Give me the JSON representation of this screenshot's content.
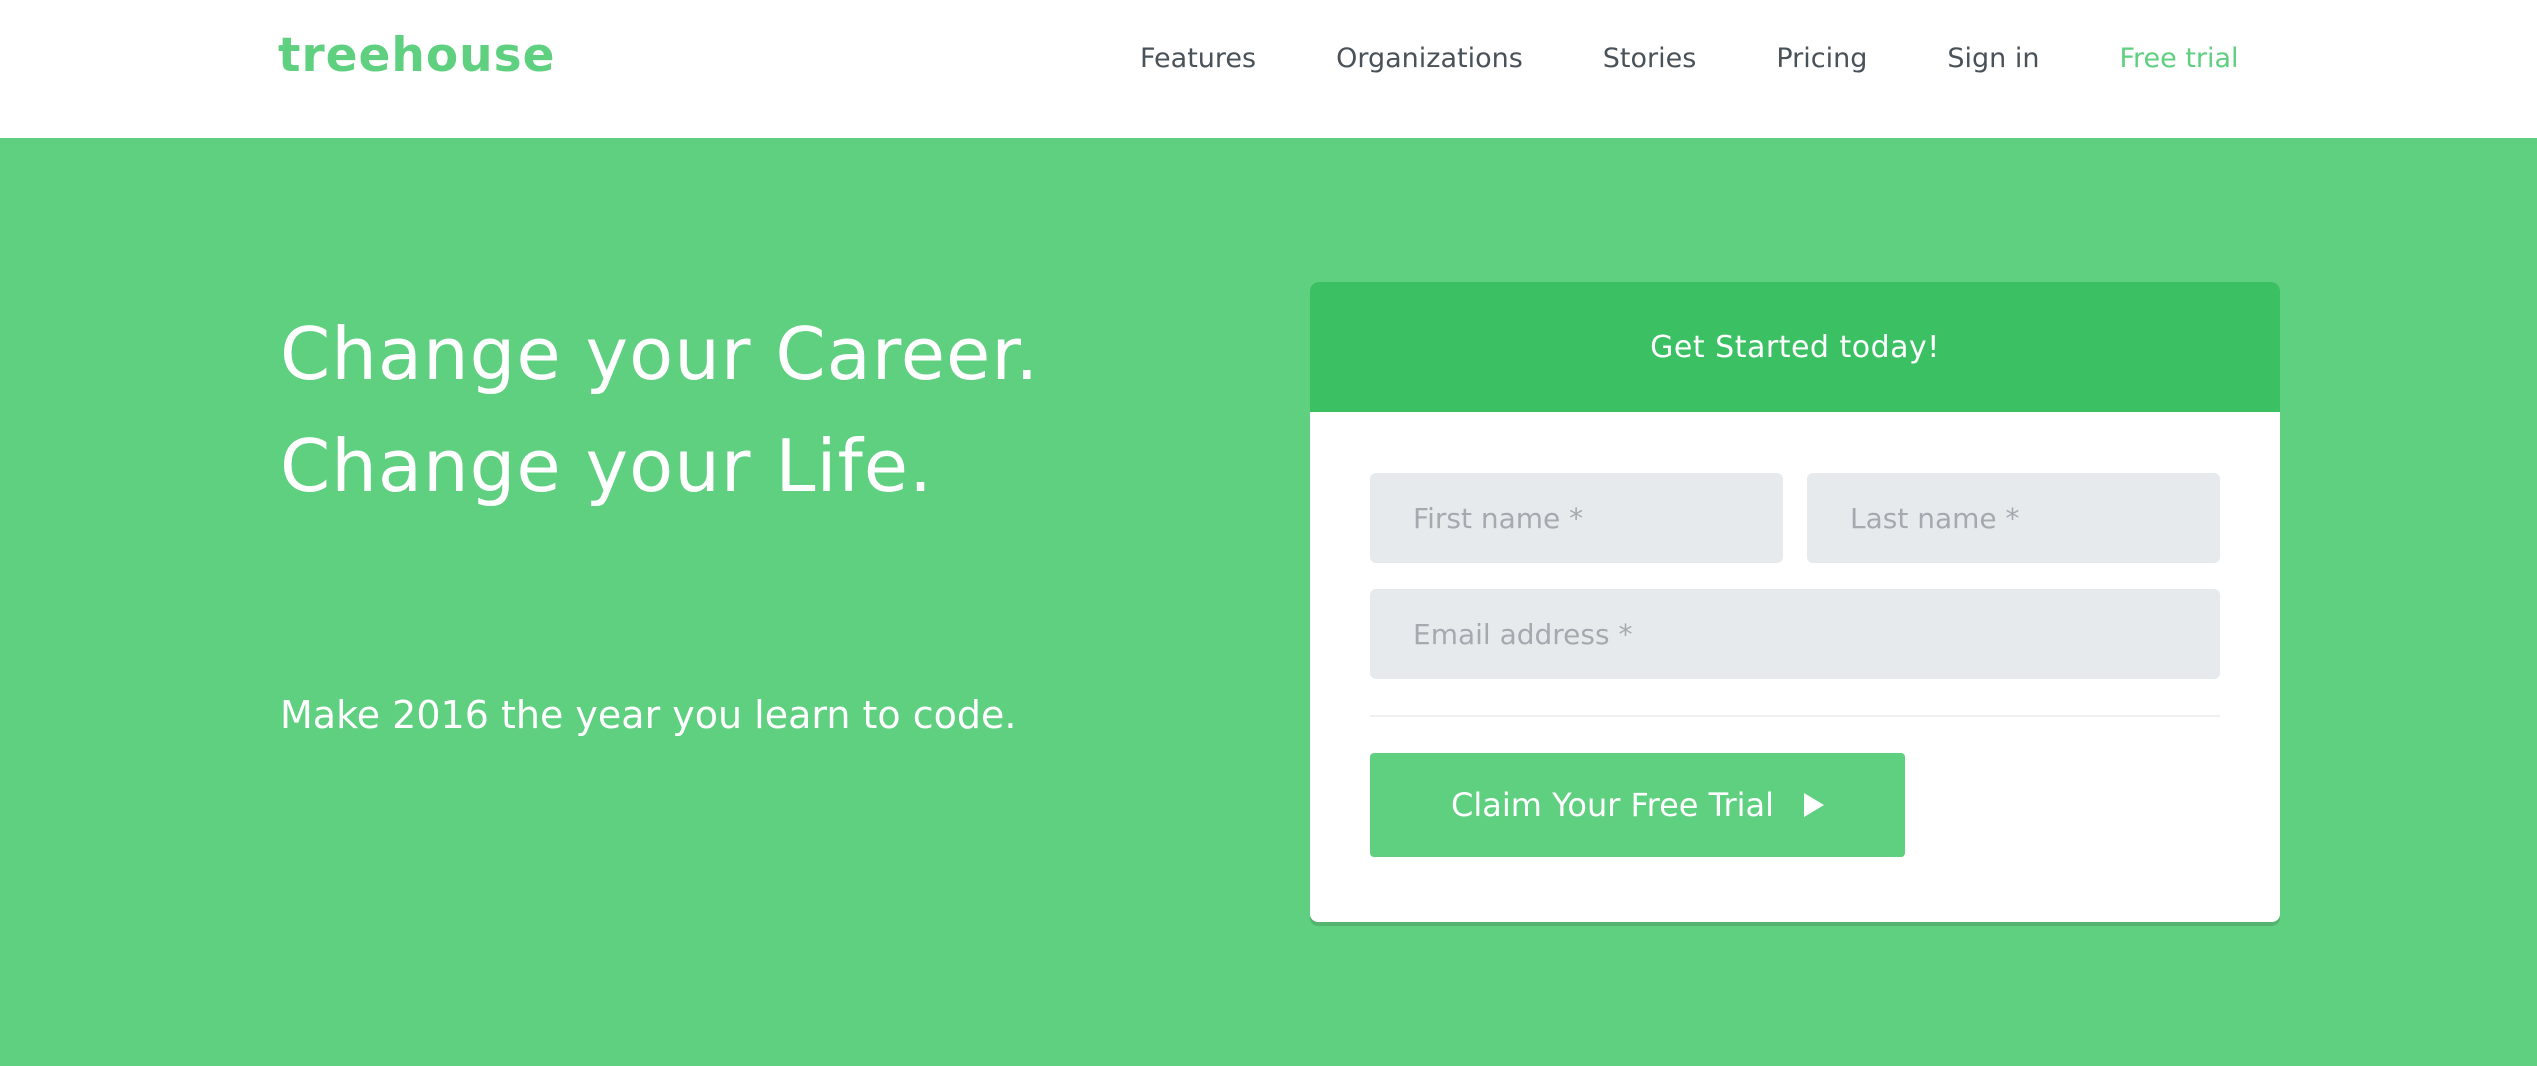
{
  "nav": {
    "logo": "treehouse",
    "links": [
      "Features",
      "Organizations",
      "Stories",
      "Pricing",
      "Sign in"
    ],
    "cta": "Free trial"
  },
  "hero": {
    "headline_1": "Change your Career.",
    "headline_2": "Change your Life.",
    "subline": "Make 2016 the year you learn to code."
  },
  "form": {
    "title": "Get Started today!",
    "first_name_placeholder": "First name *",
    "last_name_placeholder": "Last name *",
    "email_placeholder": "Email address *",
    "submit_label": "Claim Your Free Trial",
    "submit_icon": "play-icon"
  },
  "colors": {
    "brand_green": "#5fcf80",
    "header_green": "#3bc163",
    "nav_text": "#4a5259",
    "field_bg": "#e7eaed"
  }
}
